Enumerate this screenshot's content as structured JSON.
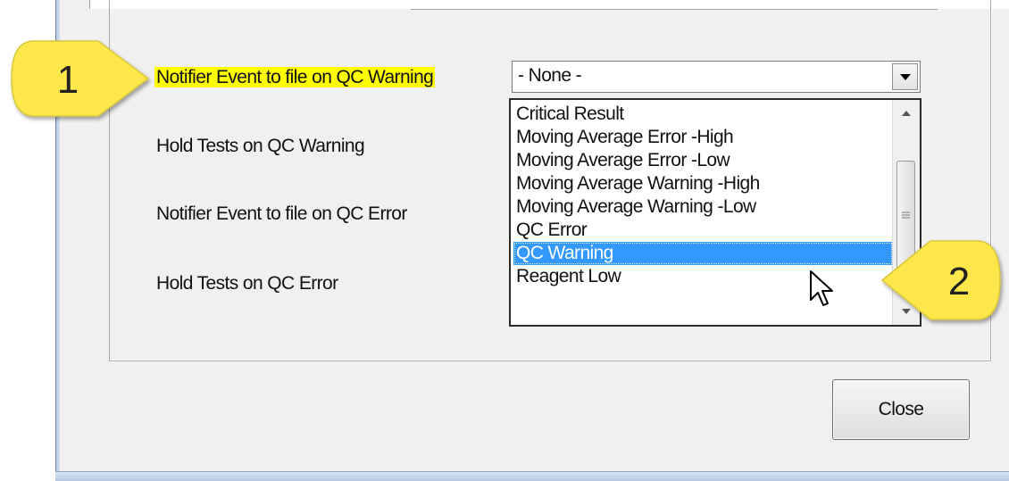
{
  "form": {
    "rows": [
      {
        "label": "Notifier Event to file on QC Warning",
        "highlighted": true
      },
      {
        "label": "Hold Tests on QC Warning",
        "highlighted": false
      },
      {
        "label": "Notifier Event to file on QC Error",
        "highlighted": false
      },
      {
        "label": "Hold Tests on QC Error",
        "highlighted": false
      }
    ],
    "highlight_color": "#ffff00"
  },
  "combo": {
    "value": "- None -",
    "options": [
      "Critical Result",
      "Moving Average Error -High",
      "Moving Average Error -Low",
      "Moving Average Warning -High",
      "Moving Average Warning -Low",
      "QC Error",
      "QC Warning",
      "Reagent Low"
    ],
    "selected": "QC Warning",
    "selection_color": "#3399ff"
  },
  "buttons": {
    "close_label": "Close"
  },
  "callouts": [
    {
      "number": "1",
      "color": "#fde74c",
      "points_to": "notifier-qc-warning-label"
    },
    {
      "number": "2",
      "color": "#fde74c",
      "points_to": "qc-warning-option"
    }
  ],
  "icons": {
    "combo_button": "chevron-down-icon",
    "scroll_up": "arrow-up-icon",
    "scroll_down": "arrow-down-icon",
    "pointer": "mouse-cursor-icon"
  }
}
